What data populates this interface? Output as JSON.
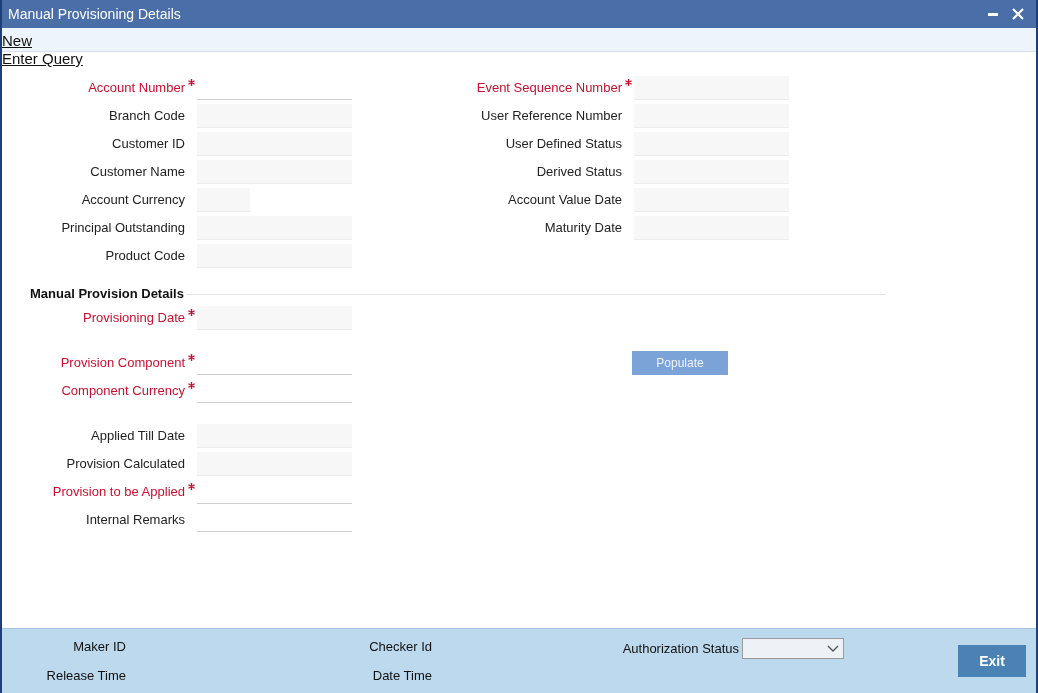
{
  "window": {
    "title": "Manual Provisioning Details"
  },
  "toolbar": {
    "links": [
      "New",
      "Enter Query"
    ]
  },
  "header_fields": {
    "left": [
      {
        "label": "Account Number",
        "required": true,
        "kind": "input"
      },
      {
        "label": "Branch Code",
        "required": false,
        "kind": "readonly"
      },
      {
        "label": "Customer ID",
        "required": false,
        "kind": "readonly"
      },
      {
        "label": "Customer Name",
        "required": false,
        "kind": "readonly"
      },
      {
        "label": "Account Currency",
        "required": false,
        "kind": "readonly-short"
      },
      {
        "label": "Principal Outstanding",
        "required": false,
        "kind": "readonly"
      },
      {
        "label": "Product Code",
        "required": false,
        "kind": "readonly"
      }
    ],
    "right": [
      {
        "label": "Event Sequence Number",
        "required": true,
        "kind": "readonly"
      },
      {
        "label": "User Reference Number",
        "required": false,
        "kind": "readonly"
      },
      {
        "label": "User Defined Status",
        "required": false,
        "kind": "readonly"
      },
      {
        "label": "Derived Status",
        "required": false,
        "kind": "readonly"
      },
      {
        "label": "Account Value Date",
        "required": false,
        "kind": "readonly"
      },
      {
        "label": "Maturity Date",
        "required": false,
        "kind": "readonly"
      }
    ]
  },
  "provision_section": {
    "title": "Manual Provision Details",
    "groups": [
      {
        "fields": [
          {
            "label": "Provisioning Date",
            "required": true,
            "kind": "readonly"
          }
        ]
      },
      {
        "fields": [
          {
            "label": "Provision Component",
            "required": true,
            "kind": "input"
          },
          {
            "label": "Component Currency",
            "required": true,
            "kind": "input"
          }
        ],
        "button": {
          "label": "Populate",
          "disabled": true
        }
      },
      {
        "fields": [
          {
            "label": "Applied Till Date",
            "required": false,
            "kind": "readonly"
          },
          {
            "label": "Provision Calculated",
            "required": false,
            "kind": "readonly"
          },
          {
            "label": "Provision to be Applied",
            "required": true,
            "kind": "input"
          },
          {
            "label": "Internal Remarks",
            "required": false,
            "kind": "input"
          }
        ]
      }
    ]
  },
  "footer": {
    "maker_id": "Maker ID",
    "release_time": "Release Time",
    "checker_id": "Checker Id",
    "date_time": "Date Time",
    "authorization_status": "Authorization Status",
    "exit_button": "Exit"
  }
}
